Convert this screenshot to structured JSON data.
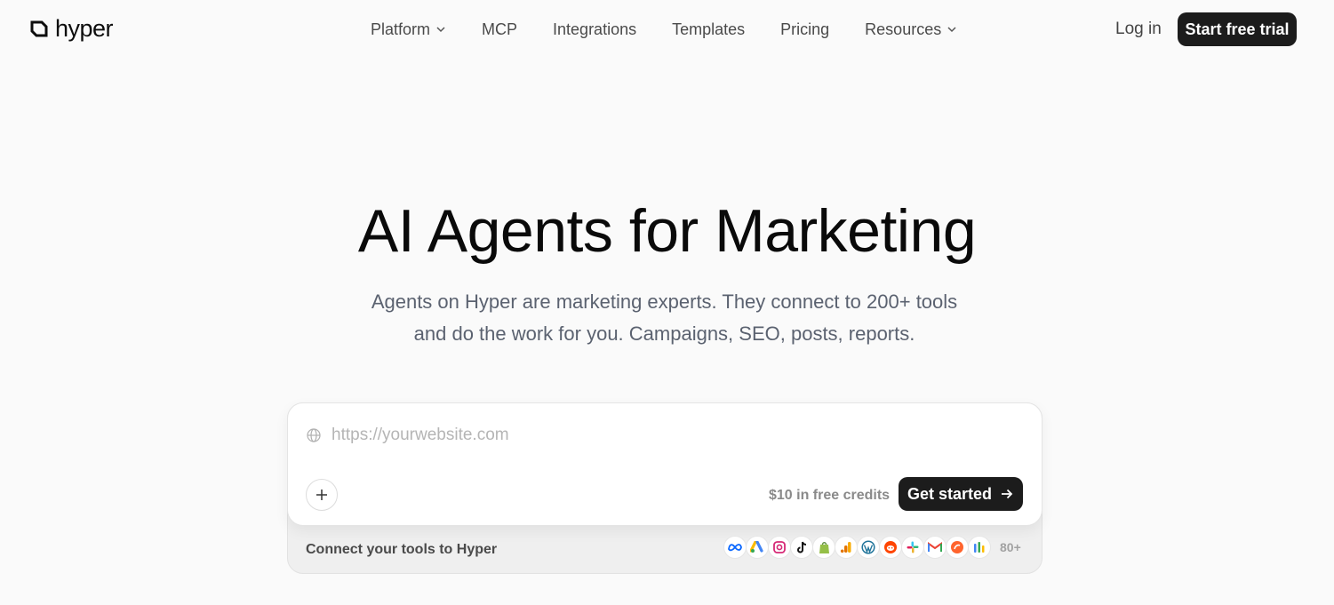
{
  "brand": {
    "name": "hyper"
  },
  "nav": {
    "items": [
      {
        "label": "Platform",
        "dropdown": true
      },
      {
        "label": "MCP",
        "dropdown": false
      },
      {
        "label": "Integrations",
        "dropdown": false
      },
      {
        "label": "Templates",
        "dropdown": false
      },
      {
        "label": "Pricing",
        "dropdown": false
      },
      {
        "label": "Resources",
        "dropdown": true
      }
    ],
    "login_label": "Log in",
    "trial_label": "Start free trial"
  },
  "hero": {
    "title": "AI Agents for Marketing",
    "subtitle_line1": "Agents on Hyper are marketing experts. They connect to 200+ tools",
    "subtitle_line2": "and do the work for you. Campaigns, SEO, posts, reports."
  },
  "prompt": {
    "url_placeholder": "https://yourwebsite.com",
    "url_value": "",
    "credits_text": "$10 in free credits",
    "submit_label": "Get started"
  },
  "tools": {
    "label": "Connect your tools to Hyper",
    "icons": [
      "meta-icon",
      "google-ads-icon",
      "instagram-icon",
      "tiktok-icon",
      "shopify-icon",
      "google-analytics-icon",
      "wordpress-icon",
      "reddit-icon",
      "slack-icon",
      "gmail-icon",
      "semrush-icon",
      "google-tag-manager-icon"
    ],
    "more_count": "80+"
  },
  "colors": {
    "background": "#fafafa",
    "button_dark": "#1c1c1c",
    "text_muted": "#5b6270"
  }
}
